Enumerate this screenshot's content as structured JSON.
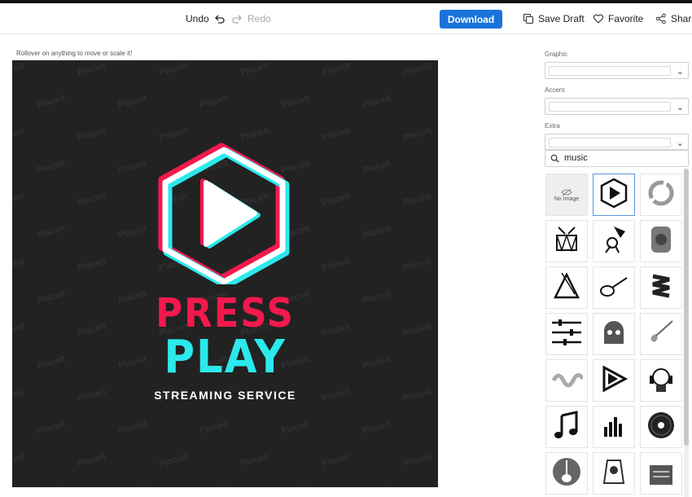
{
  "toolbar": {
    "undo_label": "Undo",
    "redo_label": "Redo",
    "download_label": "Download",
    "save_label": "Save Draft",
    "favorite_label": "Favorite",
    "share_label": "Share"
  },
  "canvas": {
    "hint": "Rollover on anything to move or scale it!",
    "watermark": "Placeit",
    "title_line1": "PRESS",
    "title_line2": "PLAY",
    "tagline": "STREAMING SERVICE",
    "colors": {
      "background": "#222222",
      "pink": "#f2194d",
      "cyan": "#2be9ec",
      "white": "#ffffff"
    }
  },
  "sidebar": {
    "fields": [
      {
        "label": "Graphic"
      },
      {
        "label": "Accent"
      },
      {
        "label": "Extra"
      }
    ],
    "search_value": "music",
    "no_image_label": "No Image",
    "thumbnails": [
      "no-image",
      "play-hexagon-icon",
      "ring-icon",
      "drum-icon",
      "gramophone-musician-icon",
      "speaker-radio-icon",
      "triangle-instrument-icon",
      "guitar-icon",
      "ribbon-icon",
      "equalizer-sliders-icon",
      "skull-icon",
      "electric-guitar-icon",
      "sound-wave-icon",
      "play-triangles-icon",
      "headphones-robot-icon",
      "music-note-icon",
      "bars-icon",
      "vinyl-record-icon",
      "guitar-circle-icon",
      "ornament-icon",
      "sheet-music-icon"
    ]
  }
}
